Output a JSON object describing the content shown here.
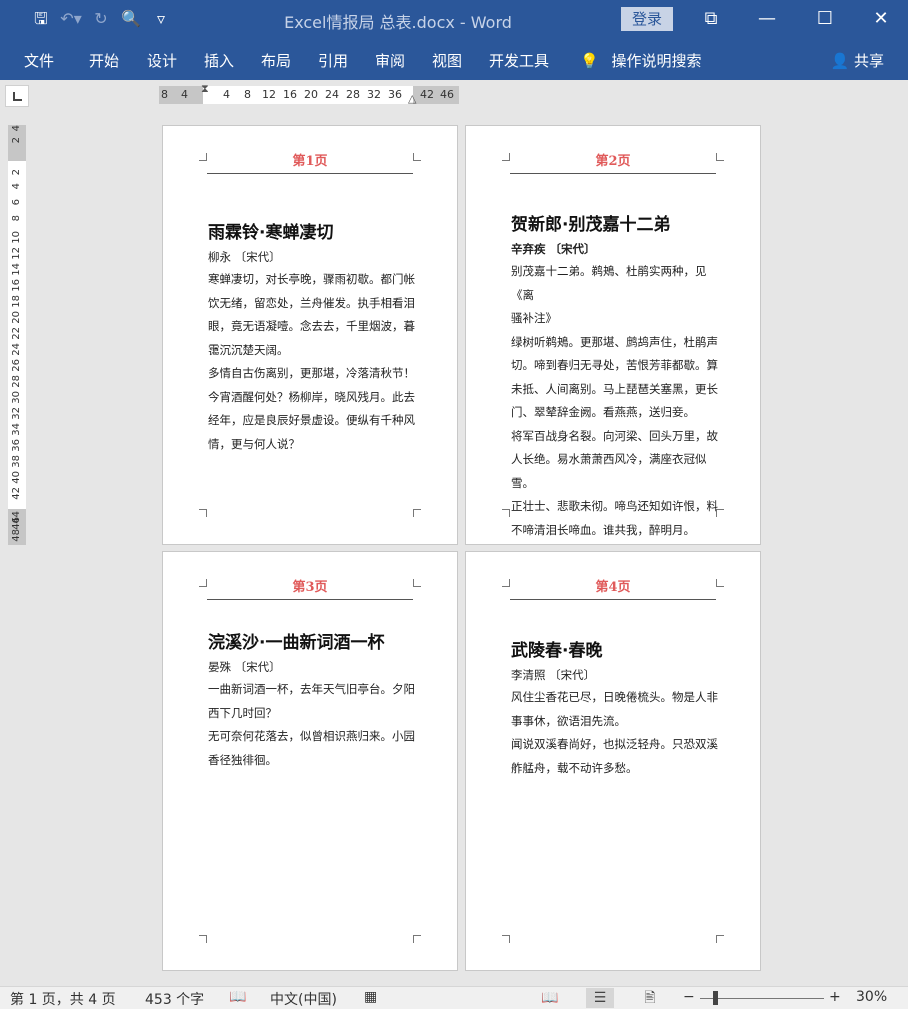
{
  "window": {
    "title": "Excel情报局 总表.docx  -  Word",
    "login_label": "登录",
    "qat_icons": [
      "save-icon",
      "undo-icon",
      "redo-icon",
      "print-preview-icon",
      "customize-icon"
    ],
    "controls": [
      "ribbon-display-icon",
      "minimize-icon",
      "maximize-icon",
      "close-icon"
    ]
  },
  "ribbon": {
    "tabs": [
      "文件",
      "开始",
      "设计",
      "插入",
      "布局",
      "引用",
      "审阅",
      "视图",
      "开发工具"
    ],
    "tell_me": "操作说明搜索",
    "share": "共享"
  },
  "ruler": {
    "h_ticks": [
      "8",
      "4",
      "4",
      "8",
      "12",
      "16",
      "20",
      "24",
      "28",
      "32",
      "36",
      "42",
      "46"
    ],
    "v_ticks": [
      "4",
      "2",
      "2",
      "4",
      "6",
      "8",
      "10",
      "12",
      "14",
      "16",
      "18",
      "20",
      "22",
      "24",
      "26",
      "28",
      "30",
      "32",
      "34",
      "36",
      "38",
      "40",
      "42",
      "44",
      "46",
      "48"
    ]
  },
  "pages": [
    {
      "header": "第1页",
      "title": "雨霖铃·寒蝉凄切",
      "author": "柳永 〔宋代〕",
      "lines": [
        "寒蝉凄切，对长亭晚，骤雨初歇。都门帐",
        "饮无绪，留恋处，兰舟催发。执手相看泪",
        "眼，竟无语凝噎。念去去，千里烟波，暮",
        "霭沉沉楚天阔。",
        "多情自古伤离别，更那堪，冷落清秋节！",
        "今宵酒醒何处？杨柳岸，晓风残月。此去",
        "经年，应是良辰好景虚设。便纵有千种风",
        "情，更与何人说？"
      ]
    },
    {
      "header": "第2页",
      "title": "贺新郎·别茂嘉十二弟",
      "author": "辛弃疾 〔宋代〕",
      "lines": [
        "别茂嘉十二弟。鹈鴂、杜鹃实两种，见《离",
        "骚补注》",
        "绿树听鹈鴂。更那堪、鹧鸪声住，杜鹃声",
        "切。啼到春归无寻处，苦恨芳菲都歇。算",
        "未抵、人间离别。马上琵琶关塞黑，更长",
        "门、翠辇辞金阙。看燕燕，送归妾。",
        "将军百战身名裂。向河梁、回头万里，故",
        "人长绝。易水萧萧西风冷，满座衣冠似雪。",
        "正壮士、悲歌未彻。啼鸟还知如许恨，料",
        "不啼清泪长啼血。谁共我，醉明月。"
      ]
    },
    {
      "header": "第3页",
      "title": "浣溪沙·一曲新词酒一杯",
      "author": "晏殊 〔宋代〕",
      "lines": [
        "一曲新词酒一杯，去年天气旧亭台。夕阳",
        "西下几时回？",
        "无可奈何花落去，似曾相识燕归来。小园",
        "香径独徘徊。"
      ]
    },
    {
      "header": "第4页",
      "title": "武陵春·春晚",
      "author": "李清照 〔宋代〕",
      "lines": [
        "风住尘香花已尽，日晚倦梳头。物是人非",
        "事事休，欲语泪先流。",
        "闻说双溪春尚好，也拟泛轻舟。只恐双溪",
        "舴艋舟，载不动许多愁。"
      ]
    }
  ],
  "status": {
    "page_info": "第 1 页，共 4 页",
    "word_count": "453 个字",
    "language": "中文(中国)",
    "zoom": "30%",
    "zoom_minus": "−",
    "zoom_plus": "+"
  }
}
